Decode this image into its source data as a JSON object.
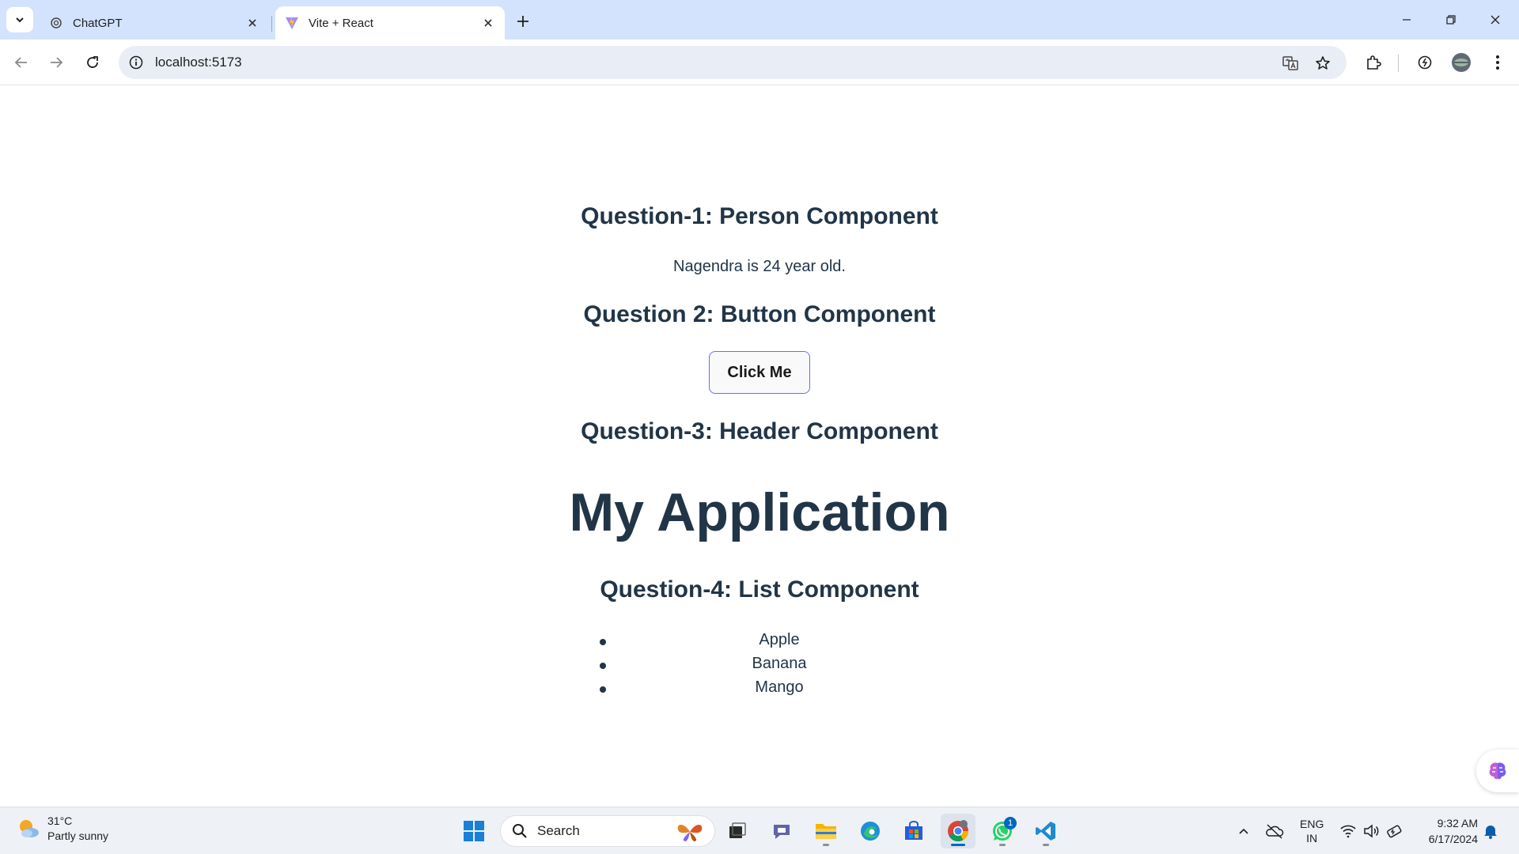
{
  "browser": {
    "tabs": [
      {
        "title": "ChatGPT",
        "favicon": "chatgpt-icon",
        "active": false
      },
      {
        "title": "Vite + React",
        "favicon": "vite-icon",
        "active": true
      }
    ],
    "address": "localhost:5173"
  },
  "page": {
    "q1_heading": "Question-1: Person Component",
    "person_text": "Nagendra is 24 year old.",
    "q2_heading": "Question 2: Button Component",
    "button_label": "Click Me",
    "q3_heading": "Question-3: Header Component",
    "app_title": "My Application",
    "q4_heading": "Question-4: List Component",
    "fruits": [
      "Apple",
      "Banana",
      "Mango"
    ]
  },
  "taskbar": {
    "weather_temp": "31°C",
    "weather_desc": "Partly sunny",
    "search_placeholder": "Search",
    "whatsapp_badge": "1",
    "lang_top": "ENG",
    "lang_bottom": "IN",
    "time": "9:32 AM",
    "date": "6/17/2024"
  },
  "colors": {
    "tabstrip": "#d3e3fd",
    "text": "#213547",
    "button_border": "#646cff",
    "accent": "#0067c0"
  }
}
